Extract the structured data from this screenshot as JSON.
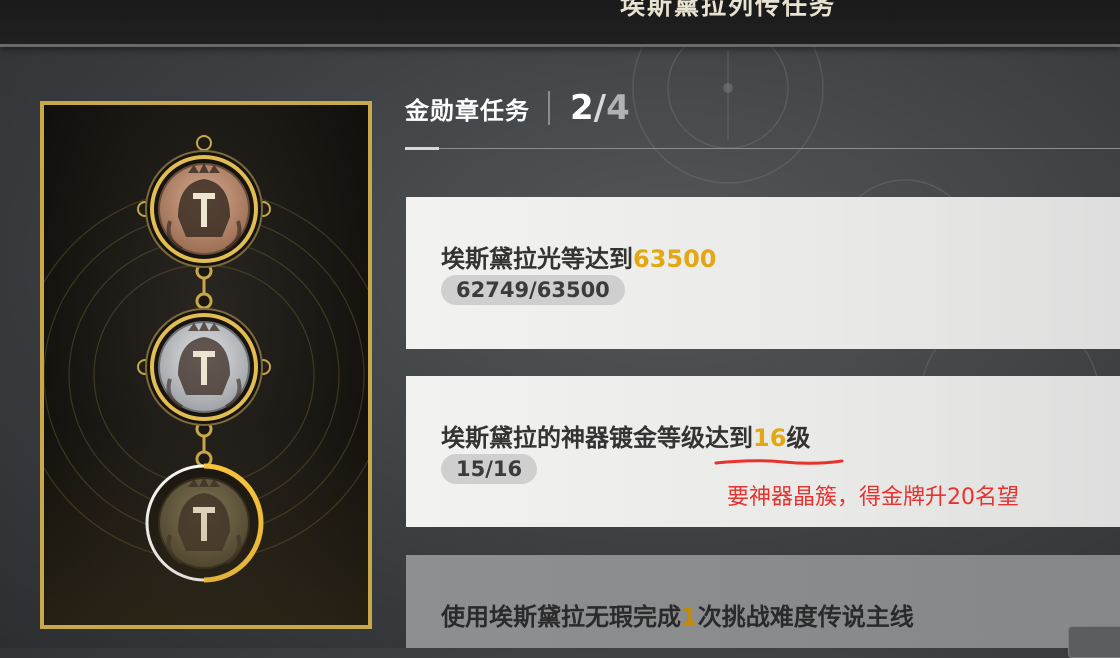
{
  "header": {
    "title": "埃斯黛拉列传任务"
  },
  "progress": {
    "label": "金勋章任务",
    "completed": "2",
    "slash": "/",
    "total": "4"
  },
  "medals": [
    {
      "tier": "bronze",
      "name": "bronze-medal-icon",
      "colors": {
        "rim": "#d9b24c",
        "face": "#b98a6d"
      }
    },
    {
      "tier": "silver",
      "name": "silver-medal-icon",
      "colors": {
        "rim": "#d9b24c",
        "face": "#c5c8cc"
      }
    },
    {
      "tier": "gold",
      "name": "gold-medal-icon",
      "selected": true,
      "progress_fraction": 0.5,
      "colors": {
        "rim": "#ffffff",
        "face": "#6f6748"
      }
    }
  ],
  "tasks": [
    {
      "prefix": "埃斯黛拉光等达到",
      "highlight": "63500",
      "suffix": "",
      "progress": "62749/63500"
    },
    {
      "prefix": "埃斯黛拉的神器镀金等级达到",
      "highlight": "16",
      "suffix": "级",
      "progress": "15/16"
    },
    {
      "prefix": "使用埃斯黛拉无瑕完成",
      "highlight": "1",
      "suffix": "次挑战难度传说主线"
    }
  ],
  "annotation": {
    "text": "要神器晶簇，得金牌升20名望",
    "color": "#e8322e"
  },
  "colors": {
    "accent_gold": "#e2a812",
    "card_border": "#c9a84a"
  }
}
